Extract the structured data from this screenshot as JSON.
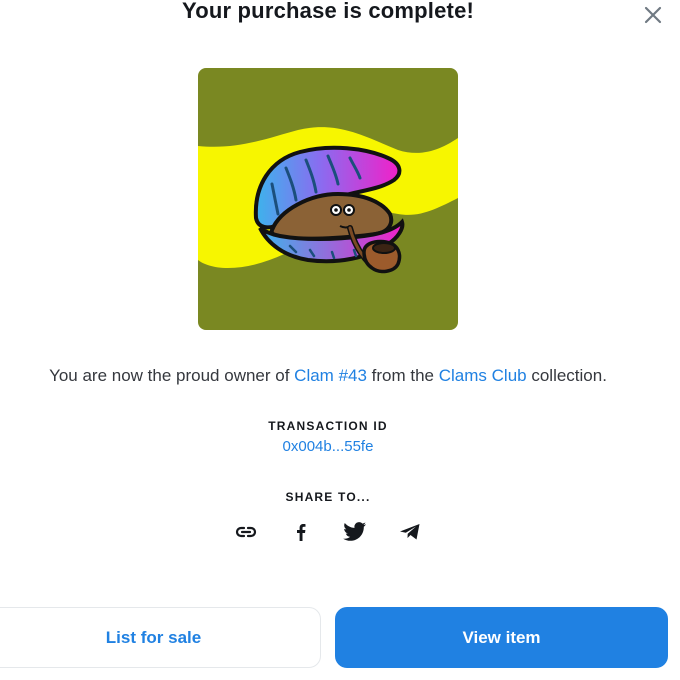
{
  "modal": {
    "title": "Your purchase is complete!",
    "close_icon": "close-icon"
  },
  "nft": {
    "image_icon": "clam-nft-artwork",
    "colors": {
      "background": "#7a8822",
      "band": "#f7f600",
      "shell_pink": "#f220c8",
      "shell_blue": "#3db3ec",
      "pipe": "#9c5b2c"
    }
  },
  "owner": {
    "prefix": "You are now the proud owner of ",
    "item_name": "Clam #43",
    "middle": " from the ",
    "collection_name": "Clams Club",
    "suffix": " collection."
  },
  "transaction": {
    "label": "TRANSACTION ID",
    "id": "0x004b...55fe"
  },
  "share": {
    "label": "SHARE TO...",
    "options": [
      "link-icon",
      "facebook-icon",
      "twitter-icon",
      "telegram-icon"
    ]
  },
  "actions": {
    "list_for_sale": "List for sale",
    "view_item": "View item"
  },
  "colors": {
    "accent": "#2081e2",
    "text": "#15181d"
  }
}
